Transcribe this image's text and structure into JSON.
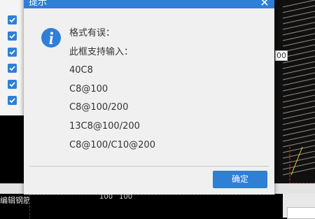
{
  "dialog": {
    "title": "提示",
    "close_glyph": "✕",
    "icon": "info-icon",
    "message_lines": [
      "格式有误：",
      "此框支持输入：",
      "40C8",
      "C8@100",
      "C8@100/200",
      "13C8@100/200",
      "C8@100/C10@200"
    ],
    "ok_label": "确定"
  },
  "background": {
    "checkbox_count": 6,
    "right_label": "00",
    "bottom_text": "编辑钢筋",
    "grid_numbers": [
      "100",
      "100"
    ]
  },
  "colors": {
    "accent": "#2f7fd6",
    "dialog_bg": "#f0f0f0"
  }
}
